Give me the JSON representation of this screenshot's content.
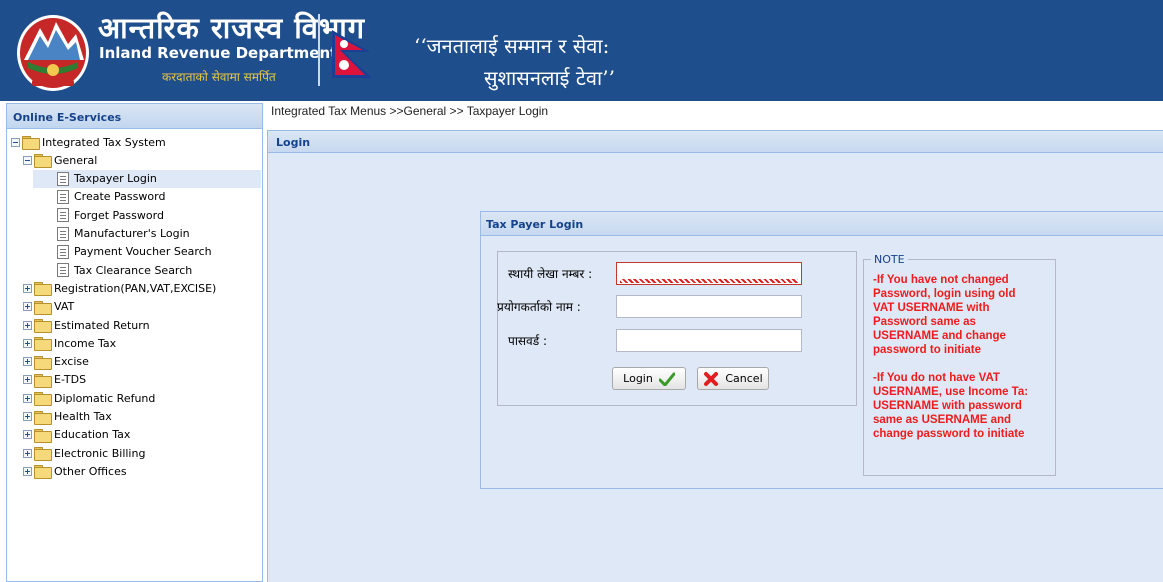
{
  "header": {
    "dept_name_np": "आन्तरिक राजस्व विभाग",
    "dept_name_en": "Inland Revenue Department",
    "dept_tagline_np": "करदाताको सेवामा समर्पित",
    "slogan_line1": "‘‘जनतालाई सम्मान र सेवा:",
    "slogan_line2": "सुशासनलाई टेवा’’",
    "colors": {
      "background": "#1f4e8c",
      "tagline": "#e8c842"
    }
  },
  "sidebar": {
    "title": "Online E-Services",
    "tree": [
      {
        "label": "Integrated Tax System",
        "level": 0,
        "type": "folder",
        "expanded": true
      },
      {
        "label": "General",
        "level": 1,
        "type": "folder",
        "expanded": true
      },
      {
        "label": "Taxpayer Login",
        "level": 2,
        "type": "leaf",
        "selected": true
      },
      {
        "label": "Create Password",
        "level": 2,
        "type": "leaf"
      },
      {
        "label": "Forget Password",
        "level": 2,
        "type": "leaf"
      },
      {
        "label": "Manufacturer's Login",
        "level": 2,
        "type": "leaf"
      },
      {
        "label": "Payment Voucher Search",
        "level": 2,
        "type": "leaf"
      },
      {
        "label": "Tax Clearance Search",
        "level": 2,
        "type": "leaf"
      },
      {
        "label": "Registration(PAN,VAT,EXCISE)",
        "level": 1,
        "type": "folder",
        "expanded": false
      },
      {
        "label": "VAT",
        "level": 1,
        "type": "folder",
        "expanded": false
      },
      {
        "label": "Estimated Return",
        "level": 1,
        "type": "folder",
        "expanded": false
      },
      {
        "label": "Income Tax",
        "level": 1,
        "type": "folder",
        "expanded": false
      },
      {
        "label": "Excise",
        "level": 1,
        "type": "folder",
        "expanded": false
      },
      {
        "label": "E-TDS",
        "level": 1,
        "type": "folder",
        "expanded": false
      },
      {
        "label": "Diplomatic Refund",
        "level": 1,
        "type": "folder",
        "expanded": false
      },
      {
        "label": "Health Tax",
        "level": 1,
        "type": "folder",
        "expanded": false
      },
      {
        "label": "Education Tax",
        "level": 1,
        "type": "folder",
        "expanded": false
      },
      {
        "label": "Electronic Billing",
        "level": 1,
        "type": "folder",
        "expanded": false
      },
      {
        "label": "Other Offices",
        "level": 1,
        "type": "folder",
        "expanded": false
      }
    ]
  },
  "breadcrumb": "Integrated Tax Menus >>General >> Taxpayer Login",
  "main_panel": {
    "title": "Login"
  },
  "login_panel": {
    "title": "Tax Payer Login",
    "fields": {
      "pan_label": "स्थायी लेखा नम्बर :",
      "pan_value": "",
      "username_label": "प्रयोगकर्ताको नाम :",
      "username_value": "",
      "password_label": "पासवर्ड :",
      "password_value": ""
    },
    "buttons": {
      "login": "Login",
      "cancel": "Cancel"
    }
  },
  "note": {
    "legend": "NOTE",
    "paragraph1": "-If You have not changed\nPassword, login using old\nVAT USERNAME with\nPassword same as\nUSERNAME and change\npassword to initiate",
    "paragraph2": "-If You do not have VAT\nUSERNAME, use Income Ta:\nUSERNAME with password\nsame as USERNAME and\nchange password to initiate",
    "color": "#ee1c1c"
  },
  "colors": {
    "panel_border": "#99bbe8",
    "panel_bg": "#dfe8f6",
    "panel_title": "#15428b"
  }
}
